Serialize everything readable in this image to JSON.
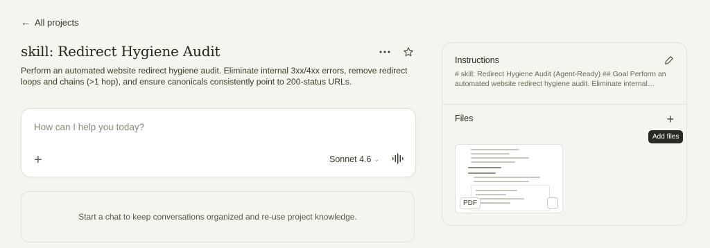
{
  "nav": {
    "back_label": "All projects"
  },
  "project": {
    "title": "skill: Redirect Hygiene Audit",
    "description": "Perform an automated website redirect hygiene audit. Eliminate internal 3xx/4xx errors, remove redirect loops and chains (>1 hop), and ensure canonicals consistently point to 200-status URLs."
  },
  "composer": {
    "placeholder": "How can I help you today?",
    "model": "Sonnet 4.6"
  },
  "empty_state": {
    "text": "Start a chat to keep conversations organized and re-use project knowledge."
  },
  "sidebar": {
    "instructions": {
      "title": "Instructions",
      "preview": "# skill: Redirect Hygiene Audit (Agent-Ready) ## Goal Perform an automated website redirect hygiene audit. Eliminate internal…"
    },
    "files": {
      "title": "Files",
      "file_badge": "PDF",
      "tooltip": "Add files"
    }
  },
  "icons": {
    "back": "arrow-left-icon",
    "more": "ellipsis-icon",
    "star": "star-icon",
    "add": "plus-icon",
    "voice": "voice-waveform-icon",
    "edit": "pencil-icon"
  }
}
